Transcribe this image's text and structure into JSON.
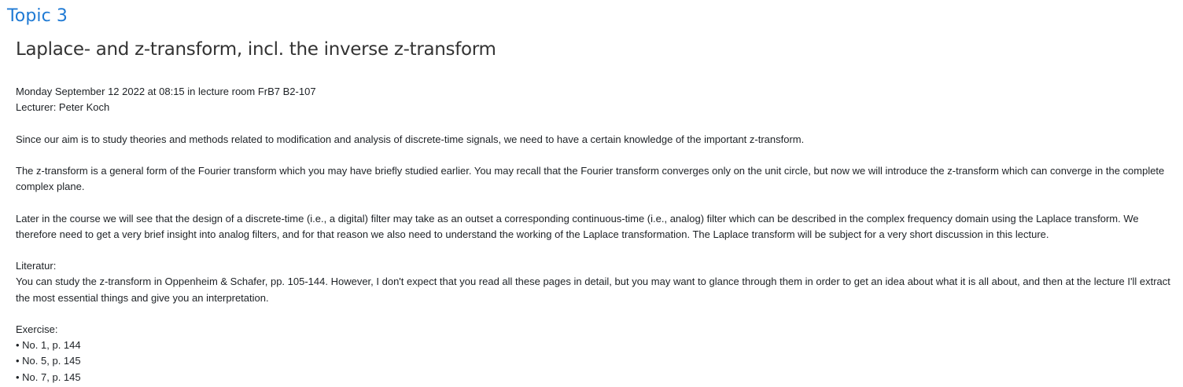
{
  "topic": {
    "title": "Topic 3"
  },
  "section": {
    "heading": "Laplace- and z-transform, incl. the inverse z-transform",
    "schedule": "Monday September 12 2022 at 08:15 in lecture room FrB7 B2-107",
    "lecturer": "Lecturer: Peter Koch",
    "paragraph_1": "Since our aim is to study theories and methods related to modification and analysis of discrete-time signals, we need to have a certain knowledge of the important z-transform.",
    "paragraph_2": "The z-transform is a general form of the Fourier transform which you may have briefly studied earlier. You may recall that the Fourier transform converges only on the unit circle, but now we will introduce the z-transform which can converge in the complete complex plane.",
    "paragraph_3": "Later in the course we will see that the design of a discrete-time (i.e., a digital) filter may take as an outset a corresponding continuous-time (i.e., analog) filter which can be described in the complex frequency domain using the Laplace transform. We therefore need to get a very brief insight into analog filters, and for that reason we also need to understand the working of the Laplace transformation. The Laplace transform will be subject for a very short discussion in this lecture.",
    "literature_label": "Literatur:",
    "literature_text": "You can study the z-transform in  Oppenheim & Schafer, pp. 105-144. However, I don't expect that you read all these pages in detail, but you may want to glance through them in order to get an idea about what it is all about, and then at the lecture I'll extract the most essential things and give you an interpretation.",
    "exercise_label": "Exercise:",
    "exercises": [
      "No. 1, p. 144",
      "No. 5, p. 145",
      "No. 7, p. 145"
    ]
  }
}
